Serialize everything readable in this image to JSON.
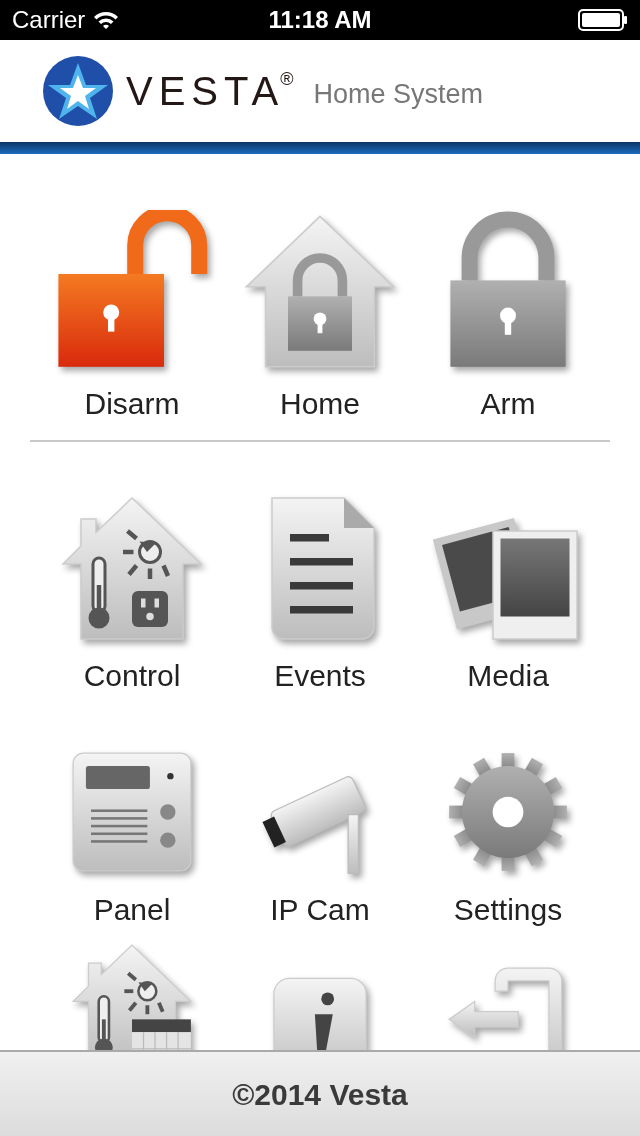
{
  "status_bar": {
    "carrier": "Carrier",
    "time": "11:18 AM"
  },
  "header": {
    "brand": "VESTA",
    "registered": "®",
    "subtitle": "Home System"
  },
  "modes": [
    {
      "label": "Disarm",
      "kind": "disarm"
    },
    {
      "label": "Home",
      "kind": "home"
    },
    {
      "label": "Arm",
      "kind": "arm"
    }
  ],
  "menu": [
    [
      {
        "label": "Control",
        "kind": "control"
      },
      {
        "label": "Events",
        "kind": "events"
      },
      {
        "label": "Media",
        "kind": "media"
      }
    ],
    [
      {
        "label": "Panel",
        "kind": "panel"
      },
      {
        "label": "IP Cam",
        "kind": "camera"
      },
      {
        "label": "Settings",
        "kind": "settings"
      }
    ],
    [
      {
        "kind": "schedule"
      },
      {
        "kind": "info"
      },
      {
        "kind": "exit"
      }
    ]
  ],
  "footer": {
    "text": "©2014 Vesta"
  }
}
